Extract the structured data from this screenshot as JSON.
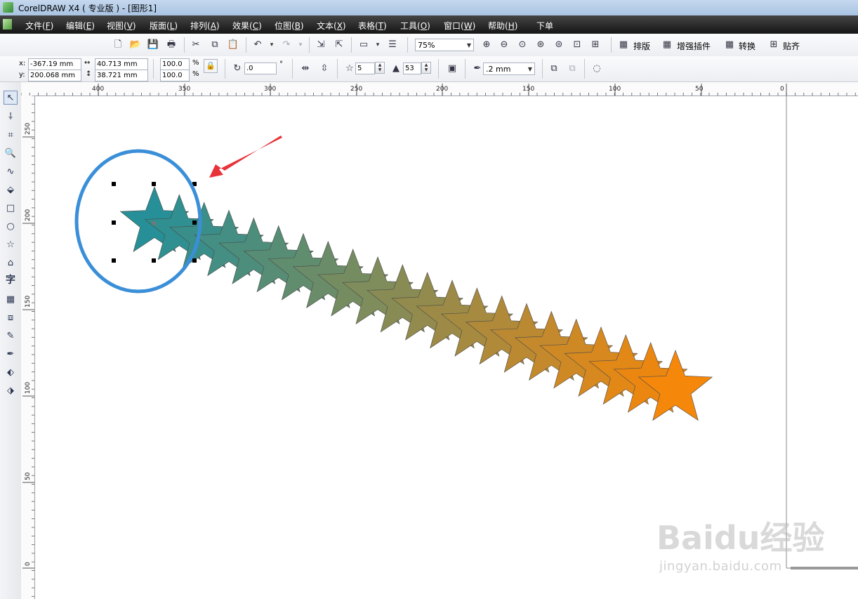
{
  "window": {
    "title": "CorelDRAW X4 ( 专业版 ) - [图形1]"
  },
  "menu": [
    {
      "label": "文件(",
      "key": "F",
      "end": ")"
    },
    {
      "label": "编辑(",
      "key": "E",
      "end": ")"
    },
    {
      "label": "视图(",
      "key": "V",
      "end": ")"
    },
    {
      "label": "版面(",
      "key": "L",
      "end": ")"
    },
    {
      "label": "排列(",
      "key": "A",
      "end": ")"
    },
    {
      "label": "效果(",
      "key": "C",
      "end": ")"
    },
    {
      "label": "位图(",
      "key": "B",
      "end": ")"
    },
    {
      "label": "文本(",
      "key": "X",
      "end": ")"
    },
    {
      "label": "表格(",
      "key": "T",
      "end": ")"
    },
    {
      "label": "工具(",
      "key": "O",
      "end": ")"
    },
    {
      "label": "窗口(",
      "key": "W",
      "end": ")"
    },
    {
      "label": "帮助(",
      "key": "H",
      "end": ")"
    },
    {
      "label": "下单",
      "key": "",
      "end": ""
    }
  ],
  "toolbar": {
    "zoom": "75%",
    "plugins": [
      {
        "label": "排版"
      },
      {
        "label": "增强插件"
      },
      {
        "label": "转换"
      },
      {
        "label": "贴齐"
      }
    ]
  },
  "properties": {
    "x_label": "x:",
    "x_value": "-367.19 mm",
    "y_label": "y:",
    "y_value": "200.068 mm",
    "width": "40.713 mm",
    "height": "38.721 mm",
    "scale_x": "100.0",
    "scale_y": "100.0",
    "percent": "%",
    "rotation": ".0",
    "degree": "°",
    "points": "5",
    "sharpness": "53",
    "outline": ".2 mm"
  },
  "rulers": {
    "origin_glyph": "⁝",
    "h_ticks": [
      "400",
      "350",
      "300",
      "250",
      "200",
      "150",
      "100",
      "50",
      "0"
    ],
    "v_ticks": [
      "250",
      "200",
      "150",
      "100",
      "50",
      "0"
    ]
  },
  "colors": {
    "blend_start": "#268f97",
    "blend_end": "#f5870a",
    "highlight_circle": "#3a8fd8",
    "arrow": "#e8333a"
  },
  "canvas": {
    "blend_star_count": 22
  },
  "watermark": {
    "logo": "Baidu经验",
    "url": "jingyan.baidu.com"
  }
}
